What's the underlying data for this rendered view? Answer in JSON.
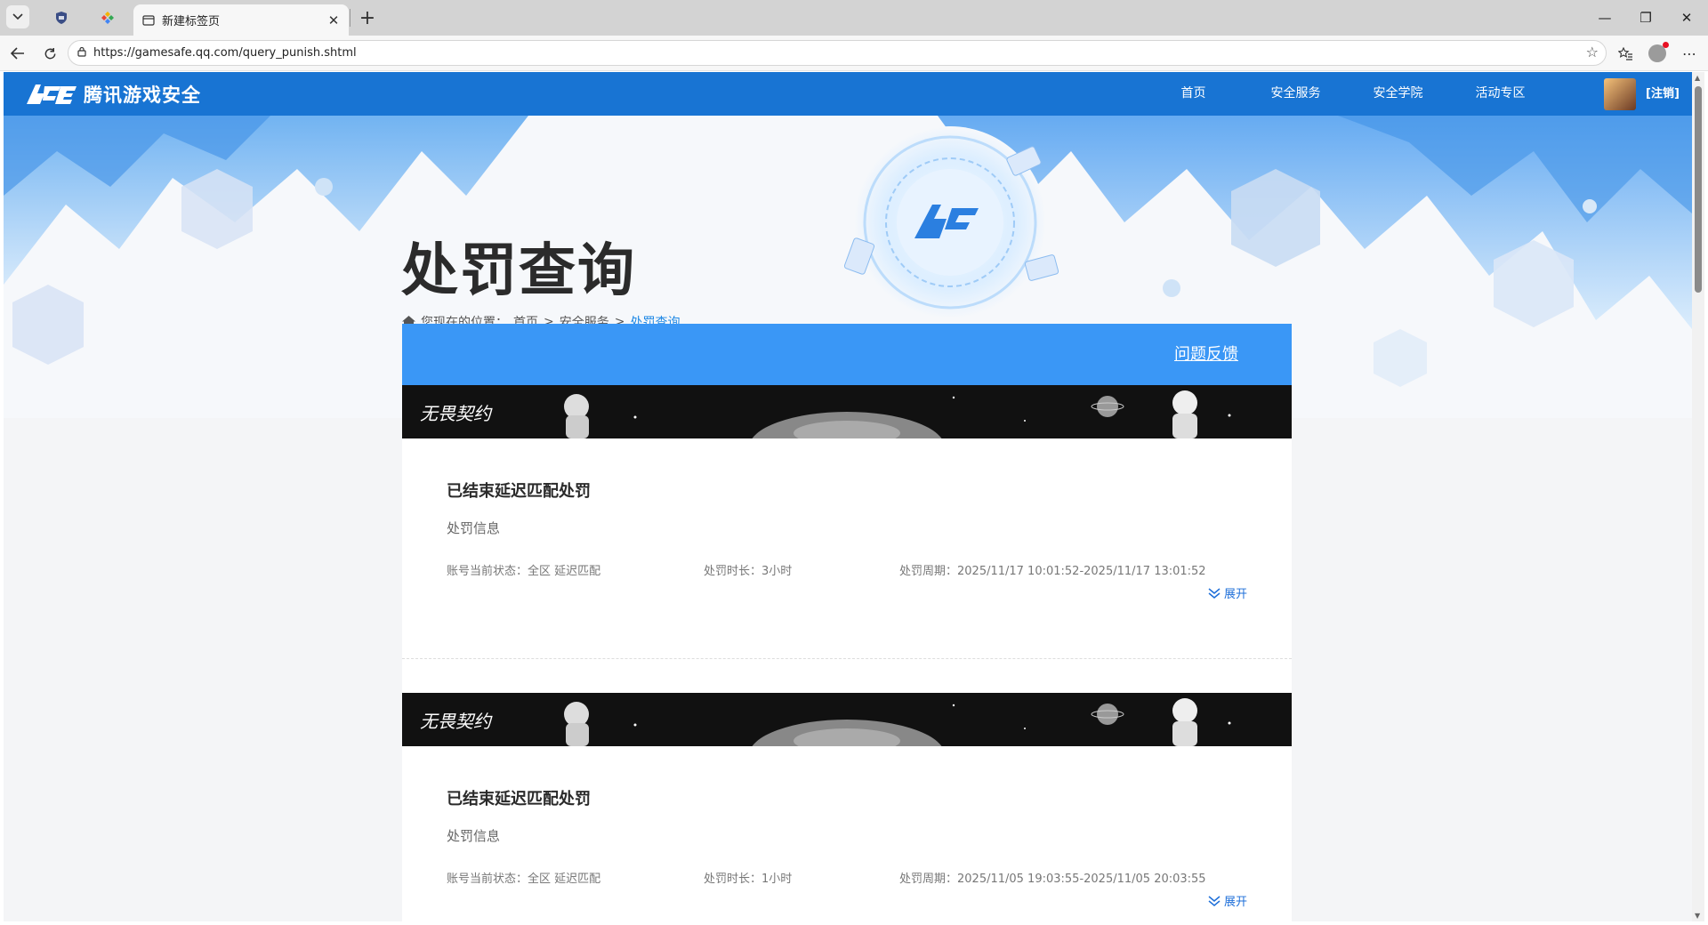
{
  "browser": {
    "active_tab_title": "新建标签页",
    "url": "https://gamesafe.qq.com/query_punish.shtml"
  },
  "site": {
    "logo_text": "腾讯游戏安全",
    "nav": [
      "首页",
      "安全服务",
      "安全学院",
      "活动专区"
    ],
    "logout": "[注销]"
  },
  "hero": {
    "title": "处罚查询",
    "breadcrumb": {
      "prefix": "您现在的位置：",
      "items": [
        "首页",
        "安全服务"
      ],
      "current": "处罚查询"
    }
  },
  "feedback": "问题反馈",
  "records": [
    {
      "game": "无畏契约",
      "title": "已结束延迟匹配处罚",
      "subtitle": "处罚信息",
      "status": "账号当前状态：全区 延迟匹配",
      "duration": "处罚时长：3小时",
      "period": "处罚周期：2025/11/17 10:01:52-2025/11/17 13:01:52",
      "expand": "展开"
    },
    {
      "game": "无畏契约",
      "title": "已结束延迟匹配处罚",
      "subtitle": "处罚信息",
      "status": "账号当前状态：全区 延迟匹配",
      "duration": "处罚时长：1小时",
      "period": "处罚周期：2025/11/05 19:03:55-2025/11/05 20:03:55",
      "expand": "展开"
    }
  ],
  "colors": {
    "header_blue": "#1874d3",
    "feedback_blue": "#3a97f6",
    "link_blue": "#1e6fd9"
  }
}
